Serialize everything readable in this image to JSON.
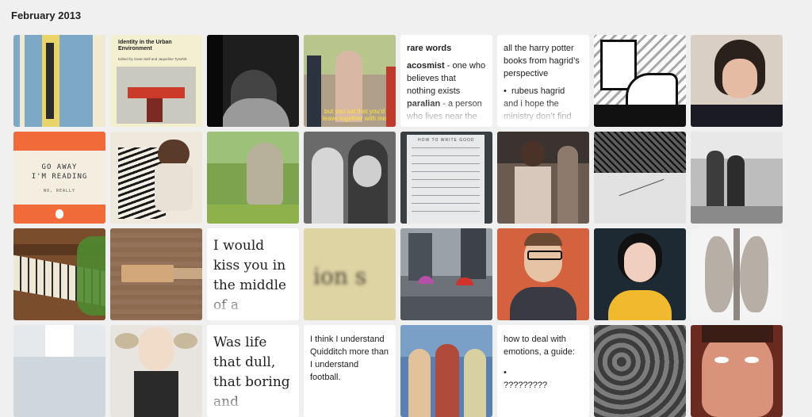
{
  "archive": {
    "month_title": "February 2013"
  },
  "tiles": {
    "rare_words": {
      "heading": "rare words",
      "term1": "acosmist",
      "def1": " - one who believes that nothing exists",
      "term2": "paralian",
      "def2": " - a person who lives near the"
    },
    "harry_potter": {
      "intro": "all the harry potter books from hagrid’s perspective",
      "bullet": "rubeus hagrid",
      "outro": "and i hope the ministry don’t find"
    },
    "go_away_book": {
      "line1": "GO AWAY",
      "line2": "I'M READING",
      "sub": "NO, REALLY"
    },
    "urban_book": {
      "title": "Identity in the Urban Environment",
      "authors": "Edited by Gwen Bell and Jaqueline Tyrwhitt"
    },
    "kiss_quote": {
      "text": "I would kiss you in the middle of a lightning"
    },
    "blurred_word": {
      "text": "ion s"
    },
    "life_quote": {
      "text": "Was life that dull, that boring and"
    },
    "quidditch": {
      "text": "I think I understand Quidditch more than I understand football."
    },
    "emotions": {
      "heading": "how to deal with emotions, a guide:",
      "bullet": "",
      "next": "?????????"
    },
    "film_caption": {
      "text": "but you sat that you’d leave together with me"
    },
    "list_photo": {
      "heading": "HOW TO WRITE GOOD"
    }
  },
  "colors": {
    "page_bg": "#f0f0f0",
    "book_orange": "#f16a3a"
  }
}
